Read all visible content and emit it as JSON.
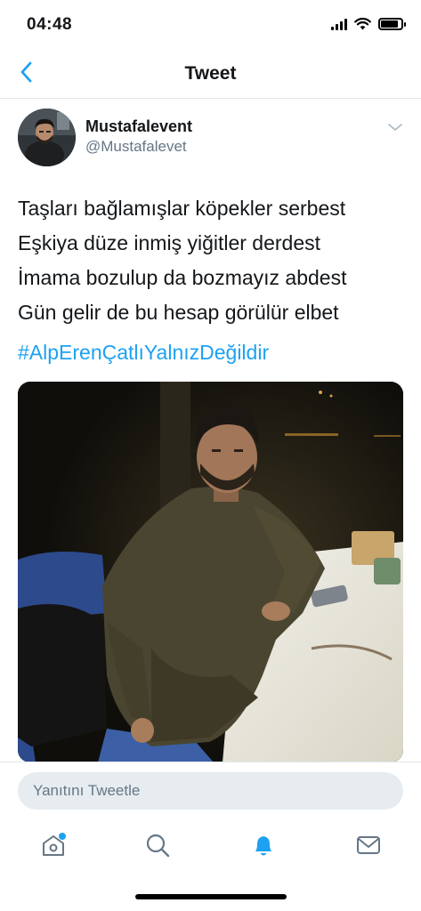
{
  "status_bar": {
    "time": "04:48"
  },
  "nav": {
    "title": "Tweet",
    "back_icon": "chevron-left-icon"
  },
  "tweet": {
    "author": {
      "name": "Mustafalevent",
      "handle": "@Mustafalevet"
    },
    "text_lines": [
      "Taşları bağlamışlar köpekler serbest",
      "Eşkiya düze inmiş yiğitler derdest",
      "İmama bozulup da bozmayız abdest",
      "Gün gelir de bu hesap görülür elbet"
    ],
    "hashtag": "#AlpErenÇatlıYalnızDeğildir",
    "menu_icon": "chevron-down-icon"
  },
  "reply": {
    "placeholder": "Yanıtını Tweetle"
  },
  "tab_bar": {
    "tabs": [
      {
        "icon": "home-icon",
        "has_notification_dot": true
      },
      {
        "icon": "search-icon"
      },
      {
        "icon": "bell-icon",
        "active": true
      },
      {
        "icon": "mail-icon"
      }
    ]
  },
  "colors": {
    "accent": "#1da1f2",
    "text_primary": "#14171a",
    "text_secondary": "#657786",
    "divider": "#e1e8ed"
  }
}
